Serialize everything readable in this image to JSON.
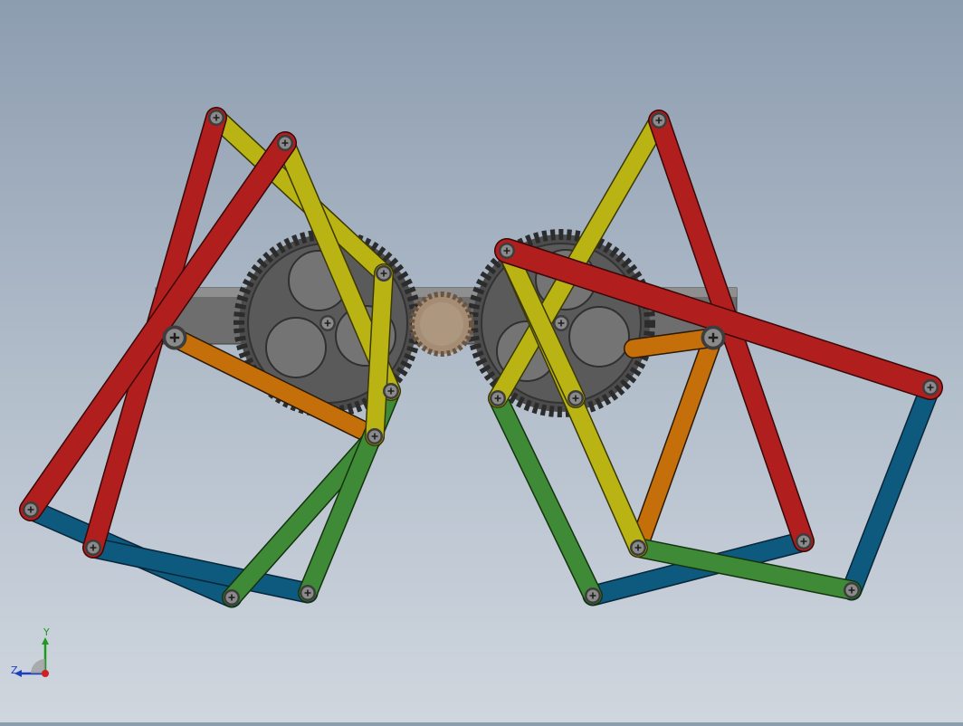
{
  "viewport": {
    "colors": {
      "bg_top": "#8d9db0",
      "bg_bottom": "#cfd6de",
      "red_link": "#b01e1e",
      "yellow_link": "#b9b314",
      "green_link": "#3e8a36",
      "blue_link": "#0e5a7f",
      "orange_link": "#c46f0a",
      "gear": "#565656",
      "pinion": "#a89078",
      "frame": "#6f6f6f"
    }
  },
  "triad": {
    "y_label": "Y",
    "z_label": "Z",
    "icons": [
      "y-axis-arrow-icon",
      "z-axis-arrow-icon",
      "origin-dot-icon"
    ]
  }
}
